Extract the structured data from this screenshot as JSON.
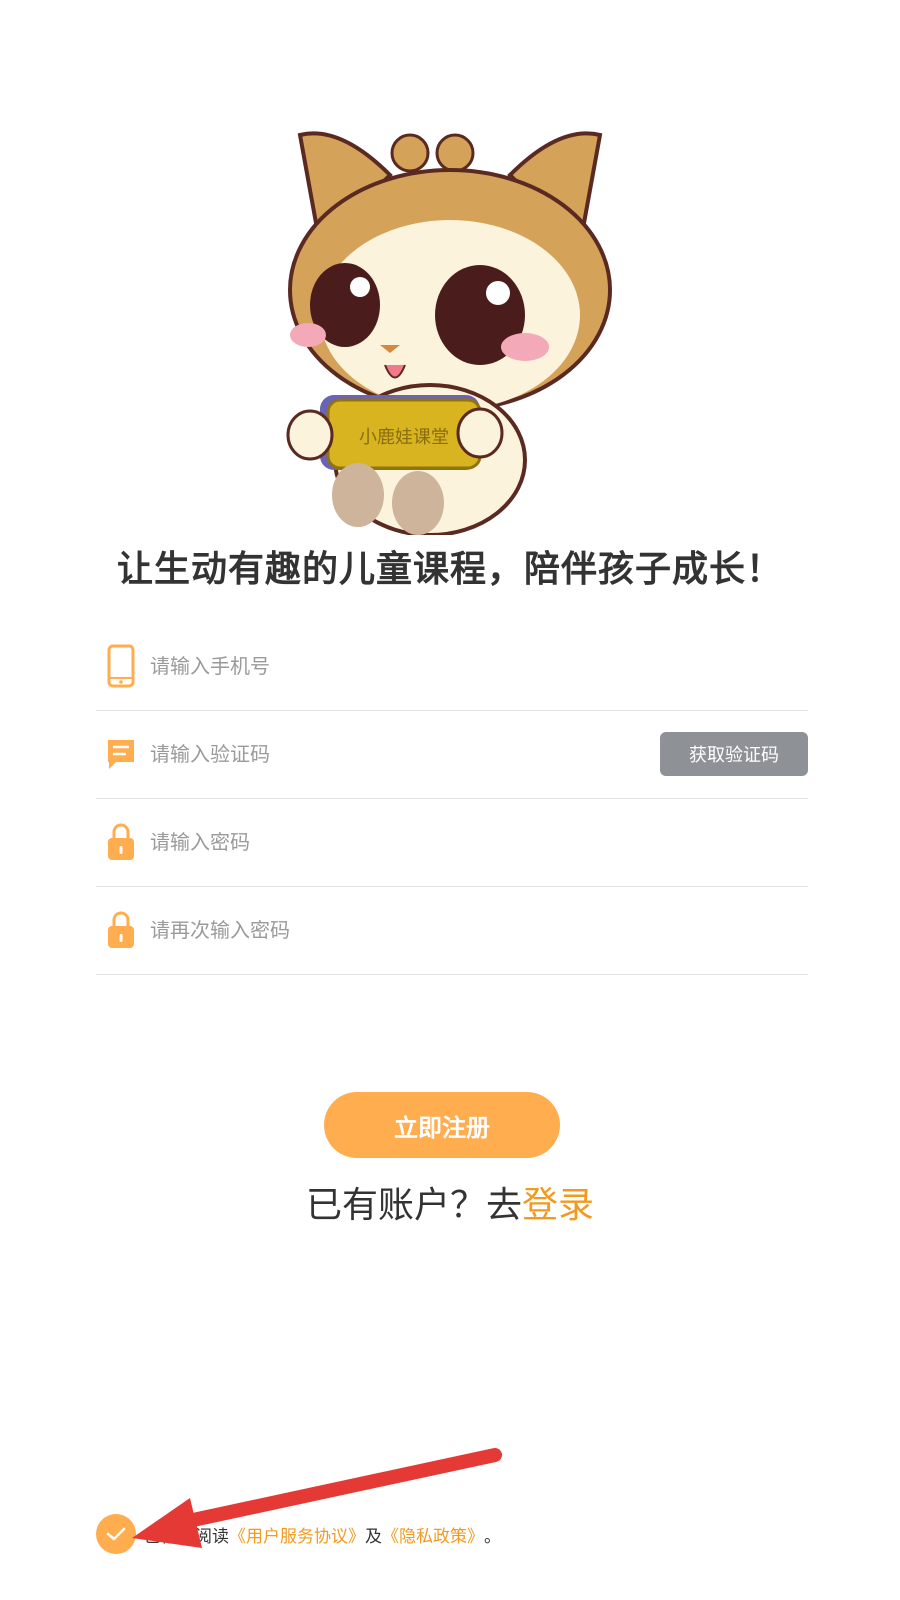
{
  "brand_colors": {
    "accent": "#ffad4f",
    "link": "#f29a1f",
    "code_button": "#8e9196",
    "annotation_arrow": "#e53935"
  },
  "mascot": {
    "badge_text": "小鹿娃课堂"
  },
  "slogan": "让生动有趣的儿童课程，陪伴孩子成长！",
  "form": {
    "phone": {
      "icon": "phone-icon",
      "placeholder": "请输入手机号"
    },
    "code": {
      "icon": "message-icon",
      "placeholder": "请输入验证码",
      "button_label": "获取验证码"
    },
    "password": {
      "icon": "lock-icon",
      "placeholder": "请输入密码"
    },
    "password_confirm": {
      "icon": "lock-icon",
      "placeholder": "请再次输入密码"
    }
  },
  "register_label": "立即注册",
  "login_prompt": {
    "text": "已有账户？去",
    "link": "登录"
  },
  "agreement": {
    "checked": true,
    "prefix": "已仔细阅读",
    "terms_link": "《用户服务协议》",
    "conjunction": "及",
    "privacy_link": "《隐私政策》",
    "suffix": "。"
  }
}
